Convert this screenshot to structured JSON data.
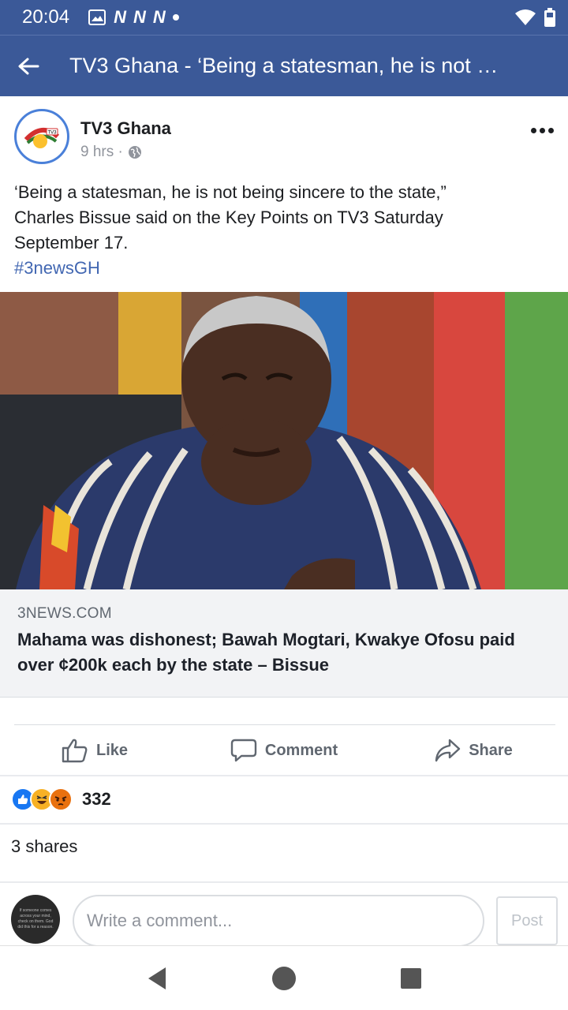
{
  "status_bar": {
    "time": "20:04",
    "notification_letters": [
      "N",
      "N",
      "N"
    ],
    "icons": [
      "image-icon",
      "wifi-icon",
      "battery-icon"
    ]
  },
  "app_bar": {
    "title": "TV3 Ghana - ‘Being a statesman, he is not …"
  },
  "post": {
    "page_name": "TV3 Ghana",
    "avatar_logo_text": "TV3",
    "time": "9 hrs ·",
    "text_lines": [
      "‘Being a statesman, he is not being sincere to the state,”",
      "Charles Bissue said on the Key Points on TV3 Saturday",
      "September 17."
    ],
    "hashtag": "#3newsGH"
  },
  "link_preview": {
    "domain": "3NEWS.COM",
    "title_line1": "Mahama was dishonest; Bawah Mogtari, Kwakye Ofosu paid",
    "title_line2": "over ¢200k each by the state – Bissue"
  },
  "actions": {
    "like": "Like",
    "comment": "Comment",
    "share": "Share"
  },
  "reactions": {
    "count": "332",
    "types": [
      "like",
      "haha",
      "angry"
    ]
  },
  "shares_text": "3 shares",
  "composer": {
    "placeholder": "Write a comment...",
    "post_label": "Post",
    "avatar_text": "If someone comes across your mind, check on them. God did this for a reason."
  },
  "colors": {
    "brand": "#3b5998",
    "link": "#4267b2",
    "muted": "#606770"
  }
}
